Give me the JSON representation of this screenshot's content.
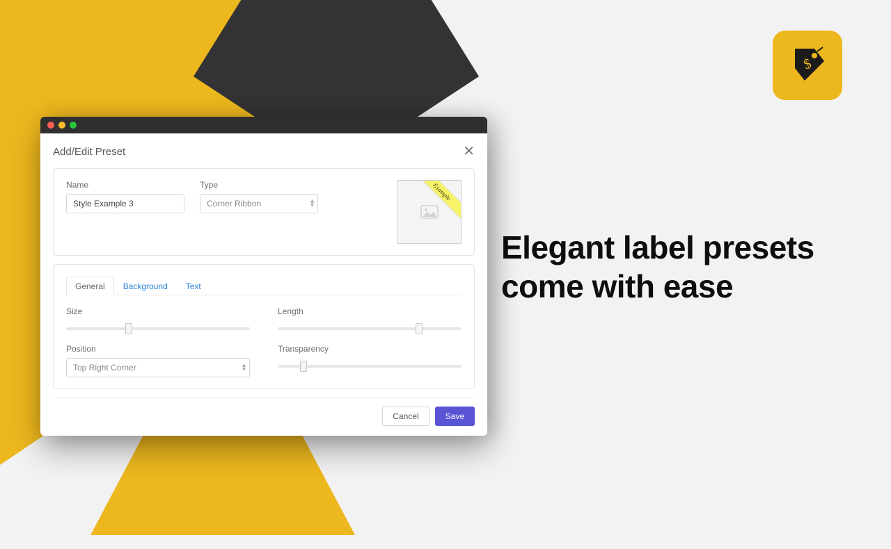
{
  "marketing": {
    "tagline": "Elegant label presets come with ease"
  },
  "modal": {
    "title": "Add/Edit Preset",
    "name_label": "Name",
    "name_value": "Style Example 3",
    "type_label": "Type",
    "type_value": "Corner Ribbon",
    "preview_ribbon": "Example"
  },
  "tabs": {
    "general": "General",
    "background": "Background",
    "text": "Text"
  },
  "general": {
    "size_label": "Size",
    "size_pct": 34,
    "length_label": "Length",
    "length_pct": 77,
    "position_label": "Position",
    "position_value": "Top Right Corner",
    "transparency_label": "Transparency",
    "transparency_pct": 14
  },
  "footer": {
    "cancel": "Cancel",
    "save": "Save"
  }
}
